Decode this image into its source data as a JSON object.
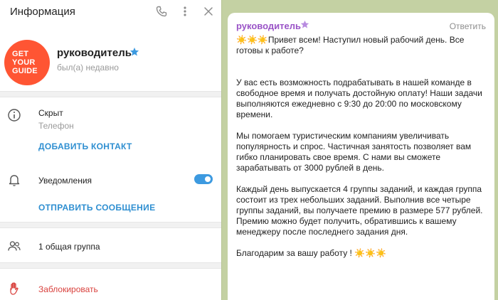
{
  "header": {
    "title": "Информация"
  },
  "profile": {
    "name": "руководитель",
    "status": "был(а) недавно",
    "avatar_text_1": "GET",
    "avatar_text_2": "YOUR",
    "avatar_text_3": "GUIDE"
  },
  "info": {
    "phone_value": "Скрыт",
    "phone_label": "Телефон",
    "add_contact": "ДОБАВИТЬ КОНТАКТ",
    "notifications_label": "Уведомления",
    "notifications_on": true,
    "send_message": "ОТПРАВИТЬ СООБЩЕНИЕ",
    "groups": "1 общая группа",
    "block": "Заблокировать"
  },
  "chat": {
    "sender": "руководитель",
    "reply": "Ответить",
    "message_intro": "Привет всем! Наступил новый рабочий день. Все готовы к работе?",
    "message_body": "У вас есть возможность подрабатывать в нашей команде в свободное время и получать достойную оплату! Наши задачи выполняются ежедневно с 9:30 до 20:00 по московскому времени.\n\nМы помогаем туристическим компаниям увеличивать популярность и спрос. Частичная занятость позволяет вам гибко планировать свое время. С нами вы сможете зарабатывать от 3000 рублей в день.\n\nКаждый день выпускается 4 группы заданий, и каждая группа состоит из трех небольших заданий. Выполнив все четыре группы заданий, вы получаете премию в размере 577 рублей. Премию можно будет получить, обратившись к вашему менеджеру после последнего задания дня.",
    "message_outro": "Благодарим за вашу работу !"
  },
  "colors": {
    "accent": "#2f8fd1",
    "danger": "#d9413d",
    "sender": "#9a54c7",
    "chat_bg": "#c4d1a3",
    "avatar": "#ff5533"
  },
  "icons": [
    "phone-icon",
    "more-icon",
    "close-icon",
    "verified-star-icon",
    "info-icon",
    "bell-icon",
    "group-icon",
    "block-hand-icon",
    "sun-emoji-icon"
  ]
}
